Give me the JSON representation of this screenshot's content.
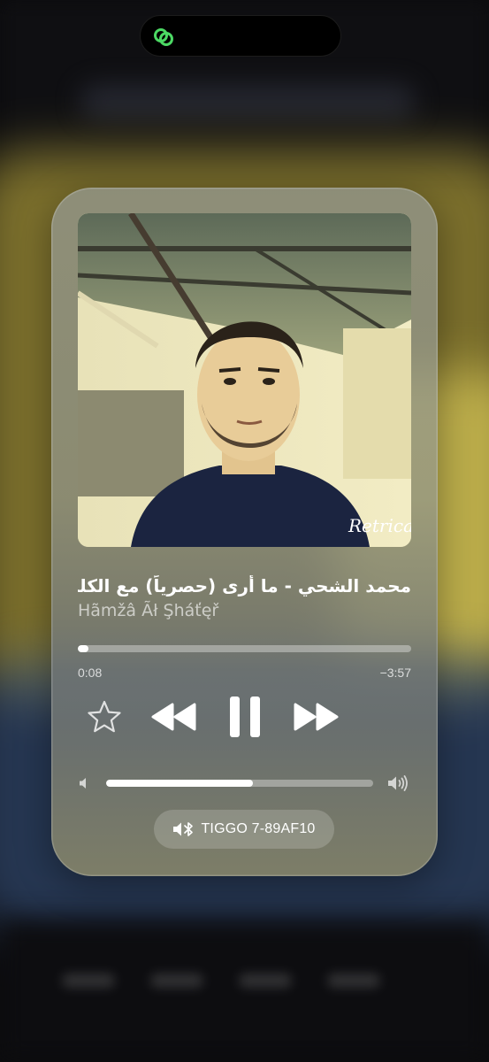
{
  "island": {
    "icon": "linked-rings-icon",
    "accent": "#4cd964"
  },
  "player": {
    "track_title": "محمد الشحي - ما أرى (حصرياً) مع الكلمات",
    "artist": "Hãmžâ Ãł Şháťęř",
    "elapsed": "0:08",
    "remaining": "−3:57",
    "progress_fraction": 0.033,
    "volume_fraction": 0.55,
    "artwork_watermark": "Retrica",
    "route_label": "TIGGO 7-89AF10",
    "controls": {
      "favorite": "star-icon",
      "previous": "backward-icon",
      "play_pause": "pause-icon",
      "next": "forward-icon"
    }
  },
  "colors": {
    "card_bg": "#969a94",
    "text_primary": "#ffffff",
    "text_secondary": "rgba(255,255,255,0.62)"
  }
}
